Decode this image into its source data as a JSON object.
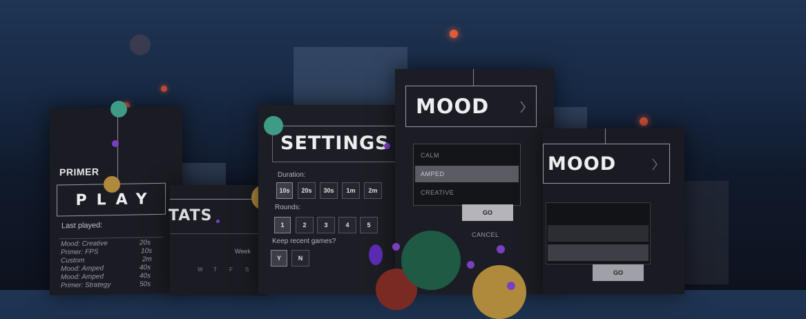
{
  "primer_card": {
    "heading": "PRIMER",
    "play_label": "PLAY",
    "last_played_label": "Last played:",
    "history": [
      {
        "mode": "Mood: Creative",
        "duration": "20s"
      },
      {
        "mode": "Primer: FPS",
        "duration": "10s"
      },
      {
        "mode": "Custom",
        "duration": "2m"
      },
      {
        "mode": "Mood: Amped",
        "duration": "40s"
      },
      {
        "mode": "Mood: Amped",
        "duration": "40s"
      },
      {
        "mode": "Primer: Strategy",
        "duration": "50s"
      }
    ]
  },
  "stats_card": {
    "title": "TATS",
    "period_label": "Week",
    "weekdays": [
      "W",
      "T",
      "F",
      "S"
    ]
  },
  "settings_card": {
    "title": "SETTINGS",
    "duration_label": "Duration:",
    "durations": [
      "10s",
      "20s",
      "30s",
      "1m",
      "2m"
    ],
    "rounds_label": "Rounds:",
    "rounds": [
      "1",
      "2",
      "3",
      "4",
      "5"
    ],
    "keep_label": "Keep recent games?",
    "keep_options": [
      "Y",
      "N"
    ]
  },
  "mood_card": {
    "title": "MOOD",
    "options": [
      "CALM",
      "AMPED",
      "CREATIVE"
    ],
    "selected": "AMPED",
    "go_label": "GO",
    "cancel_label": "CANCEL"
  },
  "mood_card_2": {
    "title": "MOOD",
    "go_label": "GO"
  },
  "colors": {
    "teal": "#3e9c86",
    "purple": "#7a3fc0",
    "gold": "#b08a3c",
    "dark_green": "#1f5a45",
    "red_orange": "#d9593a"
  },
  "icons": [
    "chevron-right-icon"
  ]
}
